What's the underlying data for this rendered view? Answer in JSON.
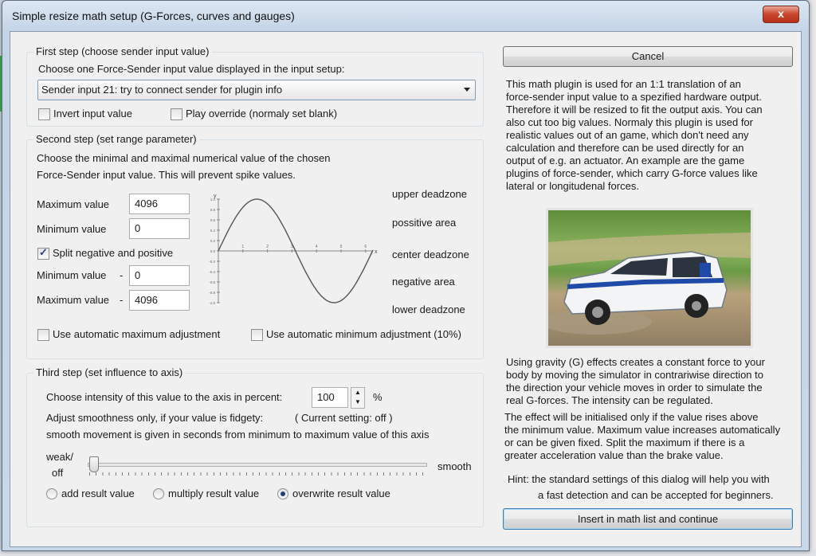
{
  "window": {
    "title": "Simple resize math setup (G-Forces, curves and gauges)",
    "close_label": "x"
  },
  "step1": {
    "title": "First step (choose sender input value)",
    "prompt": "Choose one Force-Sender input value displayed in the input setup:",
    "selected": "Sender input 21: try to connect sender for plugin info",
    "invert_label": "Invert input value",
    "invert_checked": false,
    "override_label": "Play override (normaly set blank)",
    "override_checked": false
  },
  "step2": {
    "title": "Second step (set range parameter)",
    "desc1": "Choose the minimal and maximal numerical value of the chosen",
    "desc2": "Force-Sender input value. This will prevent spike values.",
    "max_label": "Maximum value",
    "max_value": "4096",
    "min_label": "Minimum value",
    "min_value": "0",
    "split_label": "Split negative and positive",
    "split_checked": true,
    "neg_min_label": "Minimum value",
    "neg_min_value": "0",
    "neg_max_label": "Maximum value",
    "neg_max_value": "4096",
    "minus": "-",
    "zones": [
      "upper deadzone",
      "possitive area",
      "center deadzone",
      "negative area",
      "lower deadzone"
    ],
    "auto_max_label": "Use automatic maximum adjustment",
    "auto_max_checked": false,
    "auto_min_label": "Use automatic minimum adjustment (10%)",
    "auto_min_checked": false
  },
  "chart_data": {
    "type": "line",
    "ylabel": "y",
    "xlabel": "x",
    "y_ticks": [
      "1.0",
      "0.8",
      "0.6",
      "0.4",
      "0.2",
      "0.0",
      "-0.2",
      "-0.4",
      "-0.6",
      "-0.8",
      "-1.0"
    ],
    "x_ticks": [
      "1",
      "2",
      "3",
      "4",
      "5",
      "6"
    ],
    "xlim": [
      0,
      6.3
    ],
    "ylim": [
      -1.0,
      1.0
    ],
    "series": [
      {
        "values": [
          [
            0,
            0
          ],
          [
            0.5,
            0.479
          ],
          [
            1,
            0.841
          ],
          [
            1.5,
            0.997
          ],
          [
            2,
            0.909
          ],
          [
            2.5,
            0.598
          ],
          [
            3,
            0.141
          ],
          [
            3.5,
            -0.351
          ],
          [
            4,
            -0.757
          ],
          [
            4.5,
            -0.978
          ],
          [
            5,
            -0.959
          ],
          [
            5.5,
            -0.706
          ],
          [
            6,
            -0.279
          ],
          [
            6.3,
            0.017
          ]
        ]
      }
    ]
  },
  "step3": {
    "title": "Third step (set influence to axis)",
    "intensity_label": "Choose intensity of this value to the axis in percent:",
    "intensity_value": "100",
    "percent": "%",
    "smooth_label": "Adjust smoothness only, if your value is fidgety:",
    "current_setting": "( Current setting: off )",
    "smooth_desc": "smooth movement is given in seconds from minimum to maximum value of this axis",
    "weak_label": "weak/",
    "off_label": "off",
    "smooth_end_label": "smooth",
    "slider_level": 0,
    "radio_add": "add result value",
    "radio_multiply": "multiply result value",
    "radio_overwrite": "overwrite result value",
    "selected_mode": "overwrite"
  },
  "right": {
    "cancel_label": "Cancel",
    "desc_lines": [
      "This math plugin is used for an 1:1 translation of an",
      "force-sender input value to a spezified hardware output.",
      "Therefore it will be resized to fit the output axis. You can",
      "also cut too big values. Normaly this plugin is used for",
      "realistic values out of an game, which don't need any",
      "calculation and therefore can be used directly for an",
      "output of e.g. an actuator. An example are the game",
      "plugins of force-sender, which carry G-force values like",
      "lateral or longitudenal forces."
    ],
    "gravity_lines": [
      "Using gravity (G) effects creates a constant force to your",
      "body by moving the simulator in contrariwise direction to",
      "the direction your vehicle moves in order to simulate the",
      "real G-forces. The intensity can be regulated."
    ],
    "init_lines": [
      "The effect will be initialised only if the value rises above",
      "the minimum value. Maximum value increases automatically",
      "or can be given fixed. Split the maximum if there is a",
      "greater acceleration value than the brake value."
    ],
    "hint_line1": "Hint: the standard settings of this dialog will help you with",
    "hint_line2": "a fast detection and can be accepted for beginners.",
    "insert_label": "Insert in math list and continue"
  },
  "colors": {
    "accent": "#3c7fb1",
    "close": "#c9442c",
    "curve": "#555555"
  },
  "icons": {
    "close": "close-icon",
    "dropdown": "chevron-down-icon",
    "spin": "spin-arrows-icon"
  }
}
